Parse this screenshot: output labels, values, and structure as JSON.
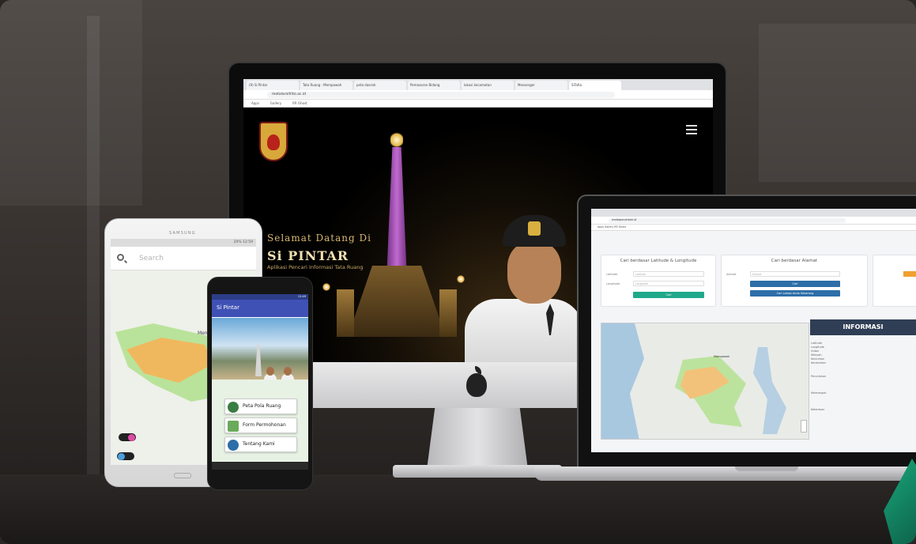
{
  "imac": {
    "browser_tabs": [
      "(9) Si Pintar",
      "Tata Ruang - Mempawah",
      "peta daerah",
      "Pemasaran Bidang",
      "lokasi kecamatan",
      "Messenger",
      "SiTaRa"
    ],
    "url": "metalarnifrito.ac.id",
    "bookmarks": [
      "Apps",
      "Gallery",
      "RR Ghost"
    ],
    "welcome_text": "Selamat Datang Di",
    "app_title": "Si PINTAR",
    "app_subtitle": "Aplikasi Pencari Informasi Tata Ruang"
  },
  "laptop": {
    "url": "metalpecahkah.id",
    "bookmarks": "Apps  Gallery  RR Ghost",
    "panel_latlong_title": "Cari berdasar Latitude & Longitude",
    "label_latitude": "Latitude",
    "label_longitude": "Longitude",
    "placeholder_latitude": "Latitude",
    "placeholder_longitude": "Longitude",
    "btn_latlong": "Cari",
    "panel_address_title": "Cari berdasar Alamat",
    "label_address": "Alamat",
    "placeholder_address": "Alamat",
    "btn_address": "Cari",
    "btn_current_location": "Cari Lokasi Anda Sekarang",
    "map_city_label": "Mempawah",
    "info_title": "INFORMASI",
    "info_fields": [
      "Latitude",
      "Longitude",
      "Hutan",
      "Wilayah",
      "Kelurahan",
      "Kecamatan",
      "Peruntukan",
      "Keterangan",
      "Ketentuan"
    ]
  },
  "samsung": {
    "brand": "SAMSUNG",
    "status_text": "20% 12:59",
    "search_placeholder": "Search",
    "map_label": "Mempawah"
  },
  "small_phone": {
    "status_text": "12:49",
    "app_title": "Si Pintar",
    "buttons": [
      {
        "label": "Peta Pola Ruang",
        "icon": "globe-icon",
        "color": "#3a7d44"
      },
      {
        "label": "Form Permohonan",
        "icon": "form-icon",
        "color": "#6aaa5a"
      },
      {
        "label": "Tentang Kami",
        "icon": "person-icon",
        "color": "#2d6ea8"
      }
    ]
  },
  "colors": {
    "accent_blue": "#3f51b5",
    "button_green": "#1fa98a",
    "button_blue": "#2d6ea8",
    "info_header": "#2f3e55",
    "map_region": "#b9e39a",
    "map_core": "#f2c27a"
  }
}
